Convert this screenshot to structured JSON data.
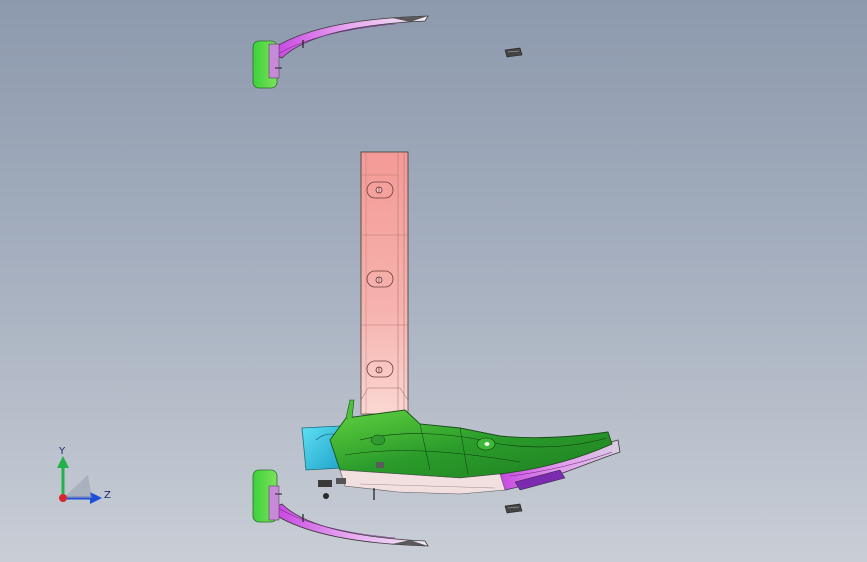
{
  "viewport": {
    "background_top": "#8d99ad",
    "background_bottom": "#c9ced6"
  },
  "model": {
    "colors": {
      "pillar": "#f4a7a3",
      "body_green": "#2bb02b",
      "trim_purple": "#b23bd6",
      "clip_cyan": "#34c8e6",
      "edge": "#3a3a3a"
    }
  },
  "triad": {
    "y_label": "Y",
    "z_label": "Z",
    "y_color": "#22b14c",
    "z_color": "#1f4fd8",
    "origin_color": "#d9262b"
  }
}
